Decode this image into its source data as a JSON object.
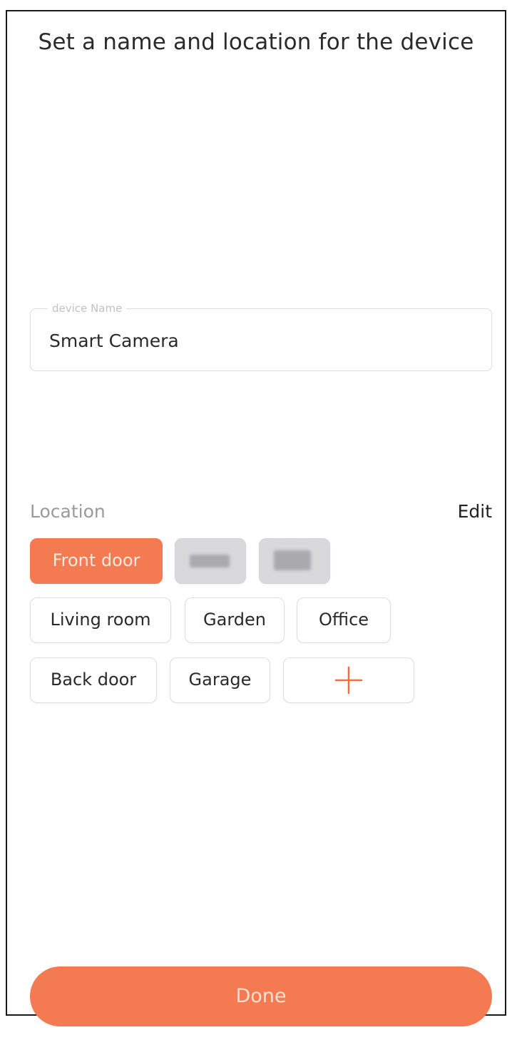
{
  "title": "Set a name and location for the device",
  "device_name_field": {
    "label": "device Name",
    "value": "Smart Camera"
  },
  "location": {
    "label": "Location",
    "edit_label": "Edit",
    "chips": [
      {
        "label": "Front door",
        "selected": true
      },
      {
        "label": "Living room"
      },
      {
        "label": "Garden"
      },
      {
        "label": "Office"
      },
      {
        "label": "Back door"
      },
      {
        "label": "Garage"
      }
    ],
    "add_icon": "plus-icon"
  },
  "done_label": "Done",
  "colors": {
    "accent": "#f47a52",
    "plus": "#f26a45"
  }
}
